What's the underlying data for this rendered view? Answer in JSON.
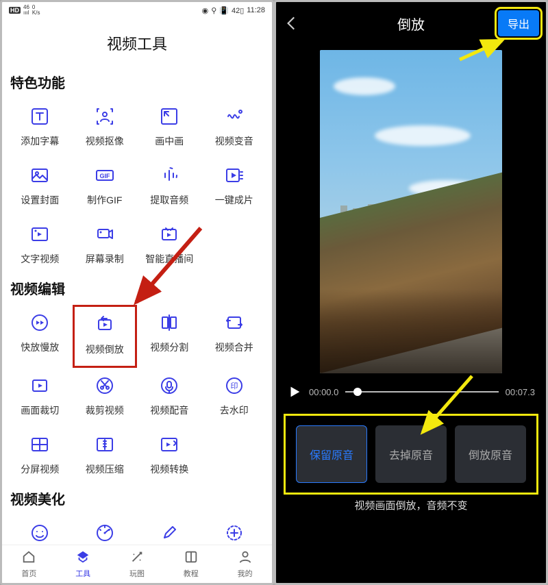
{
  "status_bar": {
    "hd": "HD",
    "net": "46",
    "signal": "ıııl",
    "speed_top": "0",
    "speed_bot": "K/s",
    "eye": "◉",
    "bt": "⚲",
    "vibr": "📳",
    "batt": "42",
    "time": "11:28"
  },
  "left": {
    "title": "视频工具",
    "sections": [
      {
        "heading": "特色功能",
        "tiles": [
          {
            "label": "添加字幕",
            "icon": "text-box-icon"
          },
          {
            "label": "视频抠像",
            "icon": "person-focus-icon"
          },
          {
            "label": "画中画",
            "icon": "pip-icon"
          },
          {
            "label": "视频变音",
            "icon": "sound-wave-icon"
          },
          {
            "label": "设置封面",
            "icon": "image-icon"
          },
          {
            "label": "制作GIF",
            "icon": "gif-icon"
          },
          {
            "label": "提取音频",
            "icon": "audio-extract-icon"
          },
          {
            "label": "一键成片",
            "icon": "auto-clip-icon"
          },
          {
            "label": "文字视频",
            "icon": "text-video-icon"
          },
          {
            "label": "屏幕录制",
            "icon": "screen-record-icon"
          },
          {
            "label": "智能直播间",
            "icon": "live-room-icon"
          }
        ]
      },
      {
        "heading": "视频编辑",
        "tiles": [
          {
            "label": "快放慢放",
            "icon": "speed-icon"
          },
          {
            "label": "视频倒放",
            "icon": "reverse-icon",
            "highlight": true
          },
          {
            "label": "视频分割",
            "icon": "split-icon"
          },
          {
            "label": "视频合并",
            "icon": "merge-icon"
          },
          {
            "label": "画面裁切",
            "icon": "crop-play-icon"
          },
          {
            "label": "裁剪视频",
            "icon": "scissors-icon"
          },
          {
            "label": "视频配音",
            "icon": "mic-icon"
          },
          {
            "label": "去水印",
            "icon": "watermark-icon"
          },
          {
            "label": "分屏视频",
            "icon": "split-screen-icon"
          },
          {
            "label": "视频压缩",
            "icon": "compress-icon"
          },
          {
            "label": "视频转换",
            "icon": "convert-icon"
          }
        ]
      },
      {
        "heading": "视频美化",
        "tiles": [
          {
            "label": "",
            "icon": "face-icon"
          },
          {
            "label": "",
            "icon": "dial-icon"
          },
          {
            "label": "",
            "icon": "brush-icon"
          },
          {
            "label": "",
            "icon": "sparkle-icon"
          }
        ]
      }
    ],
    "tabbar": [
      {
        "label": "首页",
        "icon": "home-icon"
      },
      {
        "label": "工具",
        "icon": "tools-icon",
        "active": true
      },
      {
        "label": "玩图",
        "icon": "magic-icon"
      },
      {
        "label": "教程",
        "icon": "book-icon"
      },
      {
        "label": "我的",
        "icon": "profile-icon"
      }
    ]
  },
  "right": {
    "title": "倒放",
    "export": "导出",
    "play_start": "00:00.0",
    "play_end": "00:07.3",
    "options": [
      {
        "label": "保留原音",
        "selected": true
      },
      {
        "label": "去掉原音"
      },
      {
        "label": "倒放原音"
      }
    ],
    "caption": "视频画面倒放，音频不变"
  },
  "colors": {
    "accent_indigo": "#3b3de6",
    "accent_blue": "#087af7",
    "highlight_red": "#c41f13",
    "highlight_yellow": "#f3e80e"
  }
}
